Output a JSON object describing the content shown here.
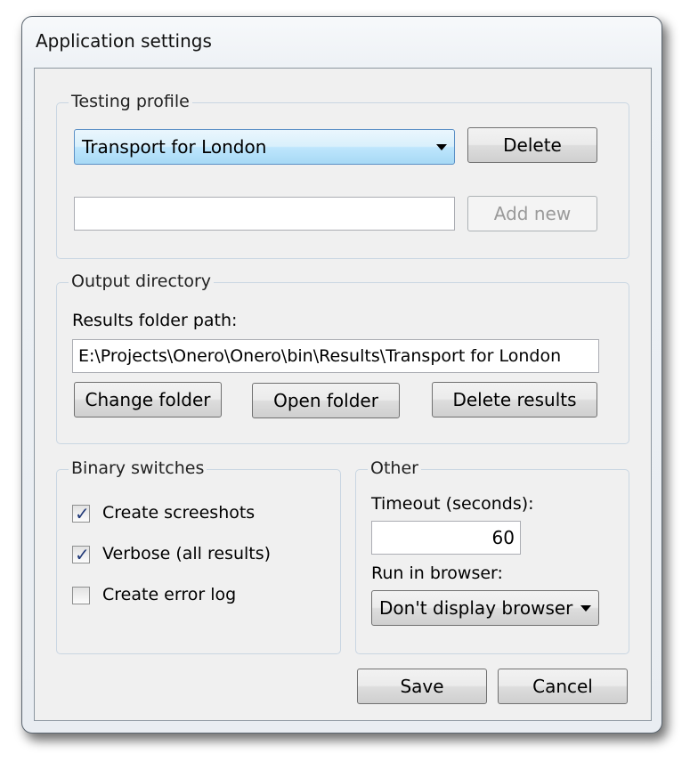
{
  "window": {
    "title": "Application settings"
  },
  "testing_profile": {
    "legend": "Testing profile",
    "selected_profile": "Transport for London",
    "delete_label": "Delete",
    "new_profile_value": "",
    "add_new_label": "Add new"
  },
  "output_directory": {
    "legend": "Output directory",
    "path_label": "Results folder path:",
    "path_value": "E:\\Projects\\Onero\\Onero\\bin\\Results\\Transport for London",
    "change_folder_label": "Change folder",
    "open_folder_label": "Open folder",
    "delete_results_label": "Delete results"
  },
  "binary_switches": {
    "legend": "Binary switches",
    "items": [
      {
        "label": "Create screeshots",
        "checked": true
      },
      {
        "label": "Verbose (all results)",
        "checked": true
      },
      {
        "label": "Create error log",
        "checked": false
      }
    ]
  },
  "other": {
    "legend": "Other",
    "timeout_label": "Timeout (seconds):",
    "timeout_value": "60",
    "browser_label": "Run in browser:",
    "browser_selected": "Don't display browser"
  },
  "footer": {
    "save_label": "Save",
    "cancel_label": "Cancel"
  }
}
